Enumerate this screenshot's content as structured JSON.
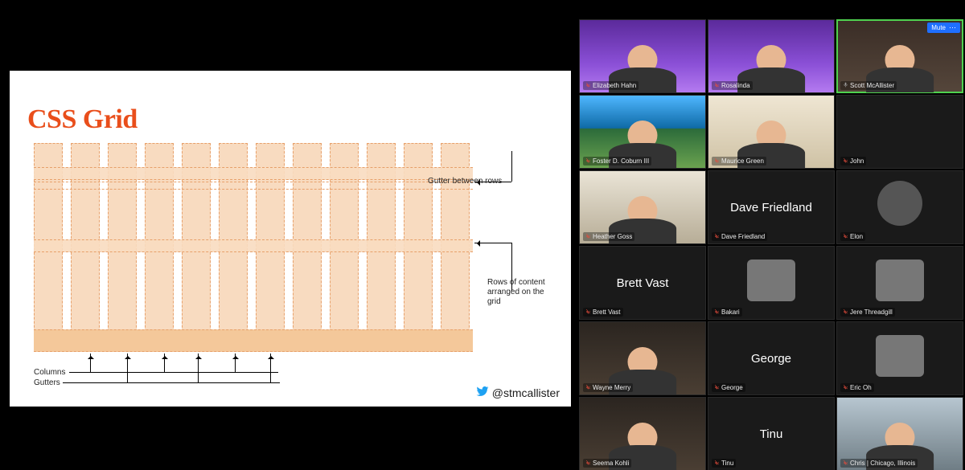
{
  "slide": {
    "title": "CSS Grid",
    "labels": {
      "gutter_rows": "Gutter between rows",
      "rows_note": "Rows of content arranged on the grid",
      "columns": "Columns",
      "gutters": "Gutters"
    },
    "twitter_handle": "@stmcallister"
  },
  "mute_button": "Mute",
  "participants": [
    {
      "name": "Elizabeth Hahn",
      "muted": true,
      "video": true,
      "bg": "bg-purple",
      "active": false
    },
    {
      "name": "Rosalinda",
      "muted": true,
      "video": true,
      "bg": "bg-purple",
      "active": false
    },
    {
      "name": "Scott McAllister",
      "muted": false,
      "video": true,
      "bg": "bg-room",
      "active": true,
      "show_mute_pill": true
    },
    {
      "name": "Foster D. Coburn III",
      "muted": true,
      "video": true,
      "bg": "bg-beach",
      "active": false
    },
    {
      "name": "Maurice Green",
      "muted": true,
      "video": true,
      "bg": "bg-couch",
      "active": false
    },
    {
      "name": "John",
      "muted": true,
      "video": false,
      "bg": "",
      "active": false
    },
    {
      "name": "Heather Goss",
      "muted": true,
      "video": true,
      "bg": "bg-office",
      "active": false
    },
    {
      "name": "Dave Friedland",
      "muted": true,
      "video": false,
      "bg": "",
      "active": false,
      "bigname": "Dave Friedland"
    },
    {
      "name": "Elon",
      "muted": true,
      "video": false,
      "bg": "",
      "active": false,
      "avatar": "circle"
    },
    {
      "name": "Brett Vast",
      "muted": true,
      "video": false,
      "bg": "",
      "active": false,
      "bigname": "Brett Vast"
    },
    {
      "name": "Bakari",
      "muted": true,
      "video": false,
      "bg": "",
      "active": false,
      "avatar": "square"
    },
    {
      "name": "Jere Threadgill",
      "muted": true,
      "video": false,
      "bg": "",
      "active": false,
      "avatar": "square"
    },
    {
      "name": "Wayne Merry",
      "muted": true,
      "video": true,
      "bg": "bg-room2",
      "active": false
    },
    {
      "name": "George",
      "muted": true,
      "video": false,
      "bg": "",
      "active": false,
      "bigname": "George"
    },
    {
      "name": "Eric Oh",
      "muted": true,
      "video": false,
      "bg": "",
      "active": false,
      "avatar": "square"
    },
    {
      "name": "Seema Kohli",
      "muted": true,
      "video": true,
      "bg": "bg-room2",
      "active": false
    },
    {
      "name": "Tinu",
      "muted": true,
      "video": false,
      "bg": "",
      "active": false,
      "bigname": "Tinu"
    },
    {
      "name": "Chris | Chicago, Illinois",
      "muted": true,
      "video": true,
      "bg": "bg-city",
      "active": false
    }
  ]
}
